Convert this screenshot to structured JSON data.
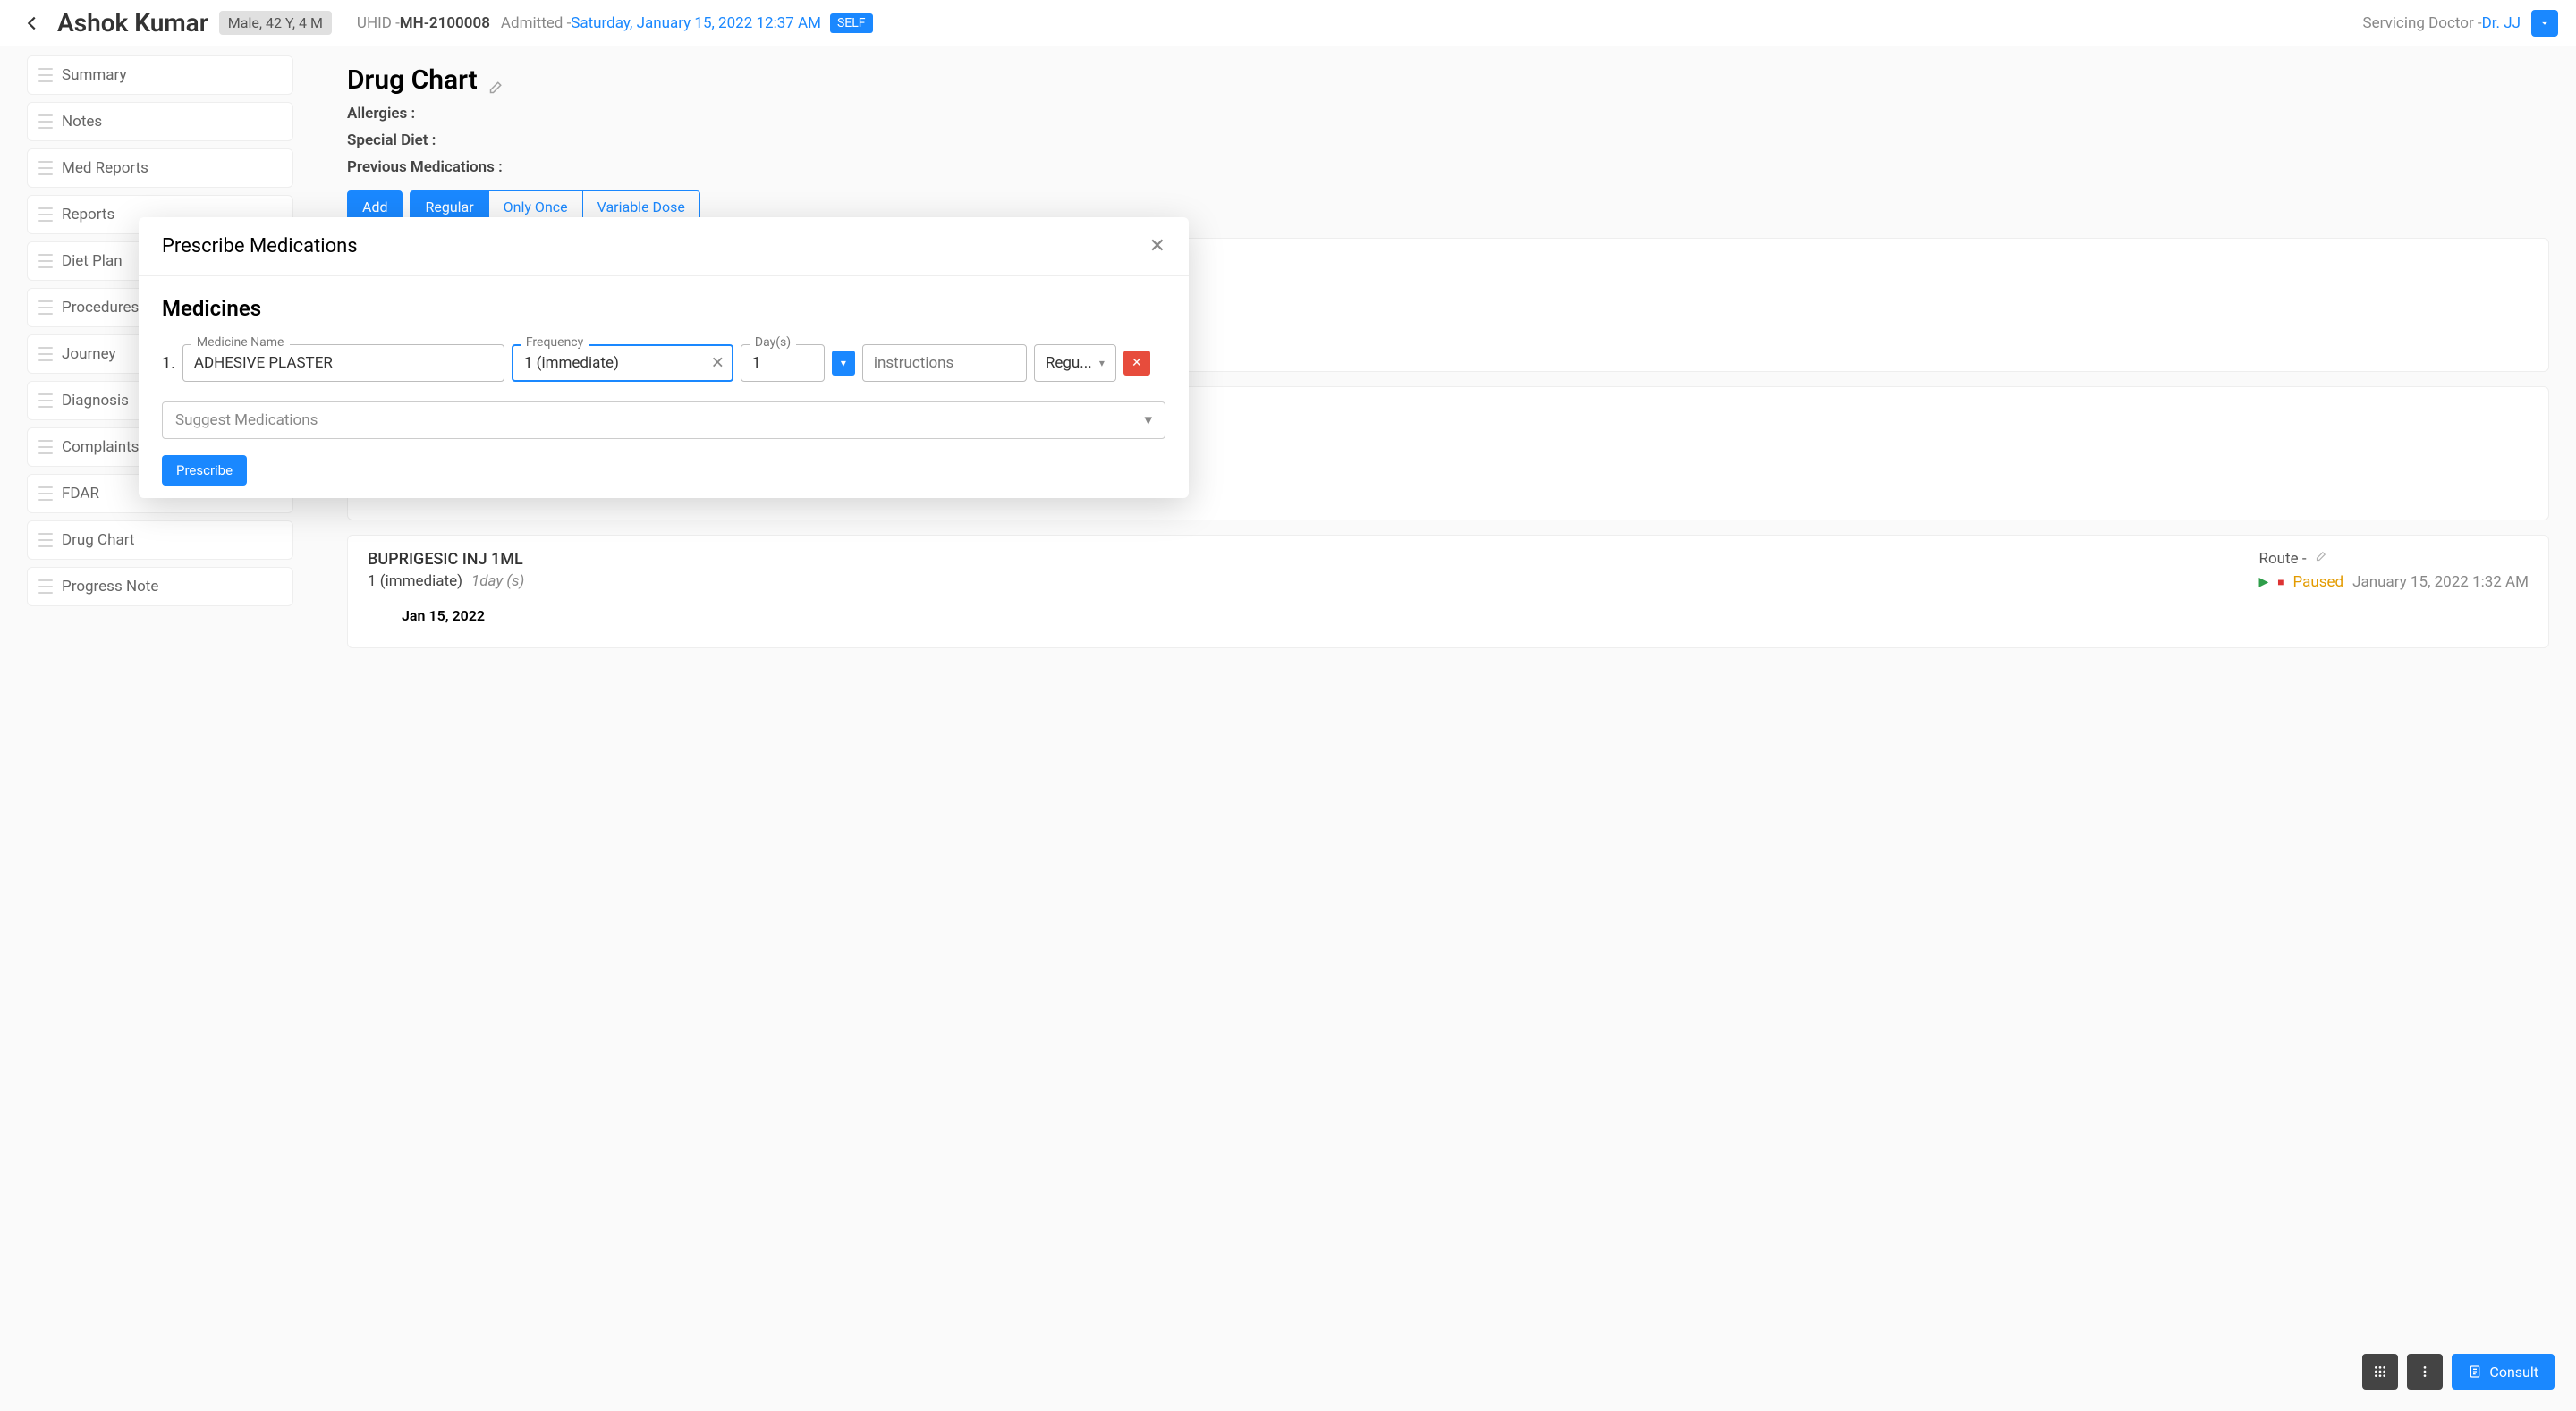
{
  "header": {
    "patient_name": "Ashok Kumar",
    "demographics": "Male, 42 Y, 4 M",
    "uhid_label": "UHID - ",
    "uhid_value": "MH-2100008",
    "admitted_label": "Admitted - ",
    "admitted_value": "Saturday, January 15, 2022 12:37 AM",
    "self_badge": "SELF",
    "serv_doc_label": "Servicing Doctor - ",
    "serv_doc_value": "Dr. JJ"
  },
  "sidebar": {
    "items": [
      {
        "label": "Summary"
      },
      {
        "label": "Notes"
      },
      {
        "label": "Med Reports"
      },
      {
        "label": "Reports"
      },
      {
        "label": "Diet Plan"
      },
      {
        "label": "Procedures"
      },
      {
        "label": "Journey"
      },
      {
        "label": "Diagnosis"
      },
      {
        "label": "Complaints"
      },
      {
        "label": "FDAR"
      },
      {
        "label": "Drug Chart"
      },
      {
        "label": "Progress Note"
      }
    ]
  },
  "content": {
    "title": "Drug Chart",
    "allergies_label": "Allergies :",
    "diet_label": "Special Diet :",
    "prev_med_label": "Previous Medications :",
    "tabs": {
      "add": "Add",
      "regular": "Regular",
      "once": "Only Once",
      "variable": "Variable Dose"
    },
    "cards": [
      {
        "name": "BUPRIGESIC INJ 1ML",
        "freq": "1 (immediate)",
        "days": "1day (s)",
        "route_label": "Route -",
        "paused": "Paused",
        "paused_time": "January 15, 2022 1:32 AM",
        "date_header": "Jan 15, 2022"
      }
    ]
  },
  "modal": {
    "title": "Prescribe Medications",
    "section": "Medicines",
    "row_num": "1.",
    "med_name_label": "Medicine Name",
    "med_name_value": "ADHESIVE PLASTER",
    "freq_label": "Frequency",
    "freq_value": "1 (immediate)",
    "days_label": "Day(s)",
    "days_value": "1",
    "instr_placeholder": "instructions",
    "type_value": "Regu...",
    "suggest_placeholder": "Suggest Medications",
    "prescribe_btn": "Prescribe"
  },
  "fab": {
    "consult": "Consult"
  }
}
